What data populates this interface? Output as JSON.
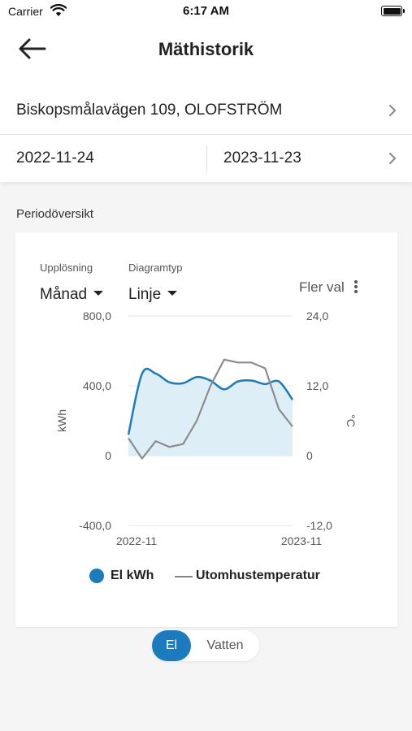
{
  "status_bar": {
    "carrier": "Carrier",
    "time": "6:17 AM"
  },
  "header": {
    "title": "Mäthistorik",
    "back_icon": "arrow-left-icon"
  },
  "address": {
    "text": "Biskopsmålavägen 109, OLOFSTRÖM"
  },
  "period": {
    "start": "2022-11-24",
    "end": "2023-11-23"
  },
  "section": {
    "title": "Periodöversikt"
  },
  "controls": {
    "resolution_label": "Upplösning",
    "resolution_value": "Månad",
    "chart_type_label": "Diagramtyp",
    "chart_type_value": "Linje",
    "more_label": "Fler val"
  },
  "legend": {
    "el": "El kWh",
    "temp": "Utomhustemperatur"
  },
  "toggle": {
    "el": "El",
    "water": "Vatten"
  },
  "colors": {
    "el": "#1a7bbf",
    "el_fill": "#deeef7",
    "temp": "#8c8c8c",
    "accent": "#1a7bbf"
  },
  "chart_data": {
    "type": "line",
    "x": [
      "2022-11",
      "2022-12",
      "2023-01",
      "2023-02",
      "2023-03",
      "2023-04",
      "2023-05",
      "2023-06",
      "2023-07",
      "2023-08",
      "2023-09",
      "2023-10",
      "2023-11"
    ],
    "x_tick_labels": [
      "2022-11",
      "2023-11"
    ],
    "series": [
      {
        "name": "El kWh",
        "axis": "left",
        "values": [
          120,
          470,
          470,
          420,
          415,
          450,
          430,
          380,
          425,
          430,
          410,
          425,
          320
        ]
      },
      {
        "name": "Utomhustemperatur",
        "axis": "right",
        "values": [
          3,
          -0.5,
          2.5,
          1.5,
          2,
          6,
          12,
          16.5,
          16,
          16,
          15,
          8,
          5
        ]
      }
    ],
    "ylabel": "kWh",
    "ylabel_right": "°C",
    "ylim": [
      -400,
      800
    ],
    "ylim_right": [
      -12,
      24
    ],
    "y_ticks": [
      "800,0",
      "400,0",
      "0",
      "-400,0"
    ],
    "y_ticks_right": [
      "24,0",
      "12,0",
      "0",
      "-12,0"
    ]
  }
}
